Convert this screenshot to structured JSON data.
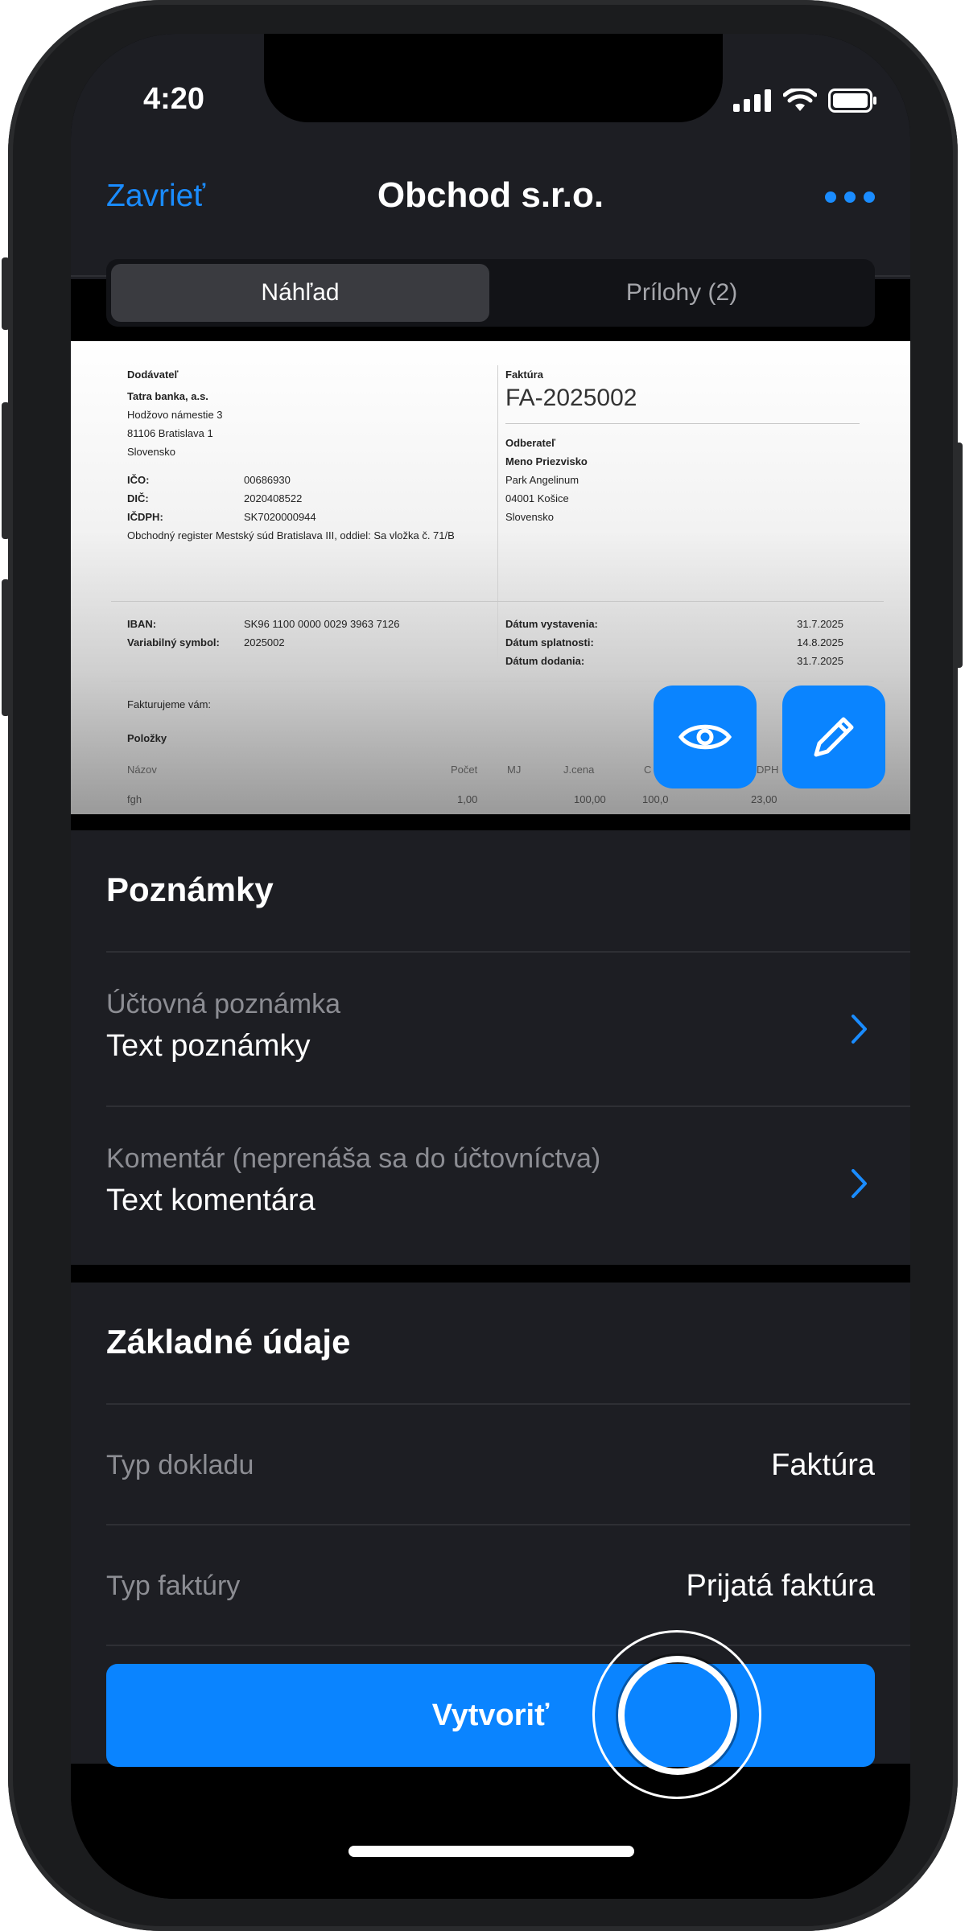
{
  "status_bar": {
    "time": "4:20",
    "icons": [
      "signal-icon",
      "wifi-icon",
      "battery-icon"
    ]
  },
  "nav": {
    "close_label": "Zavrieť",
    "title": "Obchod s.r.o.",
    "more_icon": "ellipsis-icon"
  },
  "tabs": [
    {
      "label": "Náhľad",
      "active": true
    },
    {
      "label": "Prílohy (2)",
      "active": false
    }
  ],
  "invoice": {
    "supplier_heading": "Dodávateľ",
    "supplier_name": "Tatra banka, a.s.",
    "supplier_street": "Hodžovo námestie 3",
    "supplier_city": "81106 Bratislava 1",
    "supplier_country": "Slovensko",
    "ico_label": "IČO:",
    "ico_value": "00686930",
    "dic_label": "DIČ:",
    "dic_value": "2020408522",
    "icdph_label": "IČDPH:",
    "icdph_value": "SK7020000944",
    "register": "Obchodný register Mestský súd Bratislava III, oddiel: Sa vložka č. 71/B",
    "iban_label": "IBAN:",
    "iban_value": "SK96 1100 0000 0029 3963 7126",
    "vs_label": "Variabilný symbol:",
    "vs_value": "2025002",
    "invoice_heading": "Faktúra",
    "invoice_number": "FA-2025002",
    "customer_heading": "Odberateľ",
    "customer_name": "Meno Priezvisko",
    "customer_street": "Park Angelinum",
    "customer_city": "04001 Košice",
    "customer_country": "Slovensko",
    "issue_label": "Dátum vystavenia:",
    "issue_value": "31.7.2025",
    "due_label": "Dátum splatnosti:",
    "due_value": "14.8.2025",
    "delivery_label": "Dátum dodania:",
    "delivery_value": "31.7.2025",
    "invoicing_text": "Fakturujeme vám:",
    "items_heading": "Položky",
    "col_name": "Názov",
    "col_count": "Počet",
    "col_unit": "MJ",
    "col_price": "J.cena",
    "col_total": "C",
    "col_vat": "DPH",
    "item_name": "fgh",
    "item_count": "1,00",
    "item_price": "100,00",
    "item_total": "100,0",
    "item_vat": "23,00"
  },
  "fab_icons": [
    "eye-icon",
    "pencil-icon"
  ],
  "notes": {
    "title": "Poznámky",
    "rows": [
      {
        "label": "Účtovná poznámka",
        "value": "Text poznámky"
      },
      {
        "label": "Komentár (neprenáša sa do účtovníctva)",
        "value": "Text komentára"
      }
    ]
  },
  "basic": {
    "title": "Základné údaje",
    "rows": [
      {
        "label": "Typ dokladu",
        "value": "Faktúra"
      },
      {
        "label": "Typ faktúry",
        "value": "Prijatá faktúra"
      }
    ]
  },
  "create_label": "Vytvoriť",
  "colors": {
    "accent": "#0a84ff",
    "background": "#000000",
    "card": "#1d1e23"
  }
}
